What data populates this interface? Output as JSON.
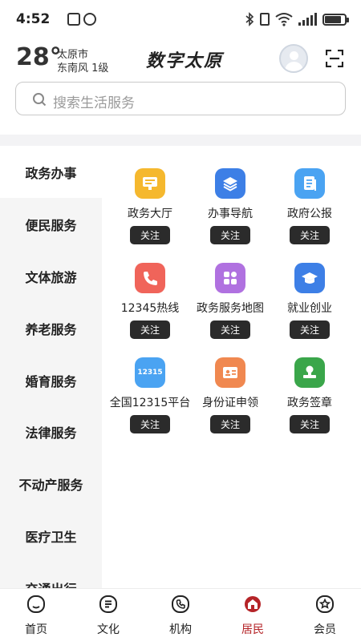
{
  "status_bar": {
    "time": "4:52"
  },
  "header": {
    "temperature": "28°",
    "city": "太原市",
    "wind": "东南风  1级",
    "app_title": "数字太原"
  },
  "search": {
    "placeholder": "搜索生活服务"
  },
  "categories": [
    {
      "label": "政务办事",
      "active": true
    },
    {
      "label": "便民服务",
      "active": false
    },
    {
      "label": "文体旅游",
      "active": false
    },
    {
      "label": "养老服务",
      "active": false
    },
    {
      "label": "婚育服务",
      "active": false
    },
    {
      "label": "法律服务",
      "active": false
    },
    {
      "label": "不动产服务",
      "active": false
    },
    {
      "label": "医疗卫生",
      "active": false
    },
    {
      "label": "交通出行",
      "active": false
    }
  ],
  "services": [
    {
      "label": "政务大厅",
      "icon": "hall-icon",
      "color": "#f5b82e",
      "follow": "关注"
    },
    {
      "label": "办事导航",
      "icon": "layers-icon",
      "color": "#3d7fe6",
      "follow": "关注"
    },
    {
      "label": "政府公报",
      "icon": "document-icon",
      "color": "#4aa3f2",
      "follow": "关注"
    },
    {
      "label": "12345热线",
      "icon": "phone-icon",
      "color": "#f0645a",
      "follow": "关注"
    },
    {
      "label": "政务服务地图",
      "icon": "grid-icon",
      "color": "#b071e0",
      "follow": "关注"
    },
    {
      "label": "就业创业",
      "icon": "graduation-cap-icon",
      "color": "#3d7fe6",
      "follow": "关注"
    },
    {
      "label": "全国12315平台",
      "icon": "badge-12315-icon",
      "badge_text": "12315",
      "color": "#4aa3f2",
      "follow": "关注"
    },
    {
      "label": "身份证申领",
      "icon": "id-card-icon",
      "color": "#f08850",
      "follow": "关注"
    },
    {
      "label": "政务签章",
      "icon": "stamp-icon",
      "color": "#3aa64a",
      "follow": "关注"
    }
  ],
  "tabs": [
    {
      "label": "首页",
      "icon": "home-icon",
      "active": false
    },
    {
      "label": "文化",
      "icon": "culture-icon",
      "active": false
    },
    {
      "label": "机构",
      "icon": "institution-icon",
      "active": false
    },
    {
      "label": "居民",
      "icon": "resident-icon",
      "active": true
    },
    {
      "label": "会员",
      "icon": "member-icon",
      "active": false
    }
  ],
  "colors": {
    "active_tab": "#b52428",
    "follow_button": "#2b2b2b"
  }
}
